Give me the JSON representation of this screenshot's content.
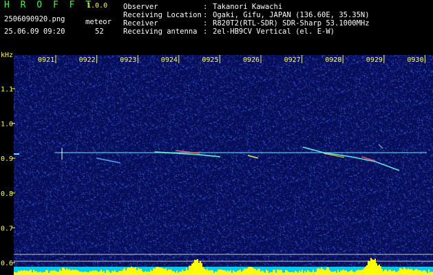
{
  "header": {
    "app_name": "H R O F F T",
    "version": "1.0.0",
    "filename": "2506090920.png",
    "datetime": "25.06.09 09:20",
    "meteor_label": "meteor",
    "meteor_count": "52",
    "meta": [
      {
        "key": "Observer",
        "value": "Takanori Kawachi"
      },
      {
        "key": "Receiving Location",
        "value": "Ogaki, Gifu, JAPAN (136.60E, 35.35N)"
      },
      {
        "key": "Receiver",
        "value": "R820T2(RTL-SDR) SDR-Sharp 53.1000MHz"
      },
      {
        "key": "Receiving antenna",
        "value": "2el-HB9CV Vertical (el. E-W)"
      }
    ]
  },
  "axes": {
    "y_unit": "kHz",
    "y_ticks": [
      "1.1",
      "1.0",
      "0.9",
      "0.8",
      "0.7",
      "0.6"
    ],
    "time_ticks": [
      "0921",
      "0922",
      "0923",
      "0924",
      "0925",
      "0926",
      "0927",
      "0928",
      "0929",
      "0930"
    ]
  },
  "colors": {
    "background": "#000000",
    "noise_base": "#0a1a6e",
    "axis_text": "#ffff33",
    "carrier": "#66ddff",
    "power_bar": "#ffff00",
    "power_base": "#00ccee"
  }
}
